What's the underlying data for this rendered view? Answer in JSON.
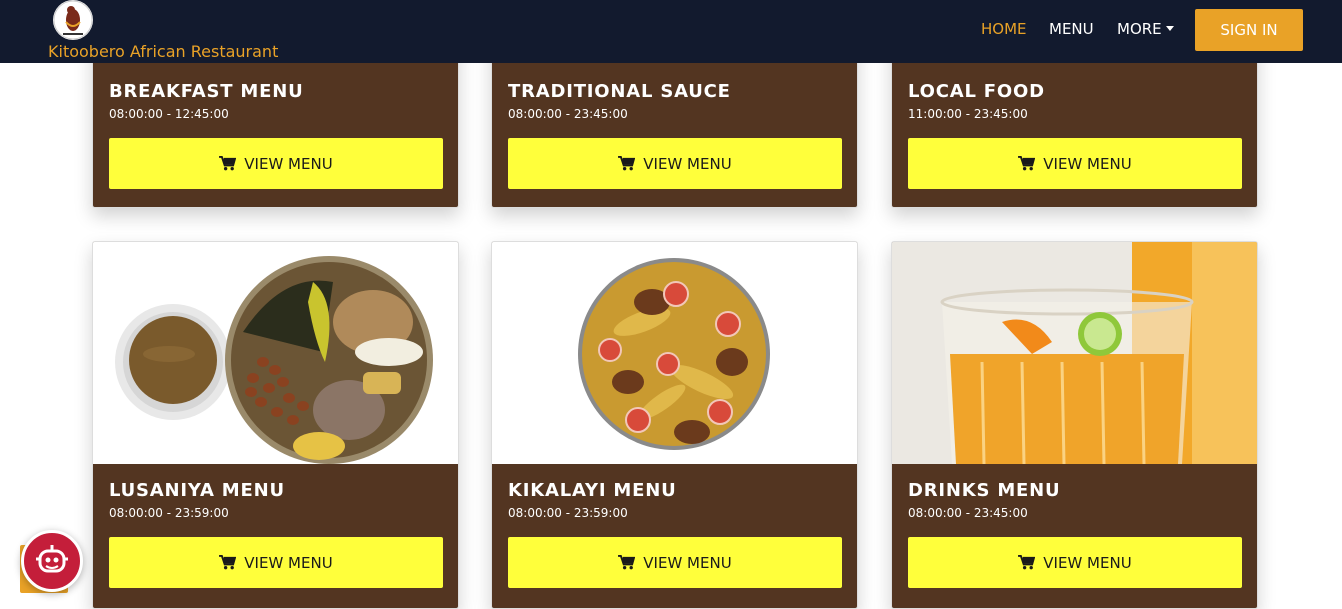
{
  "brand": {
    "name": "Kitoobero African Restaurant",
    "logo_icon": "restaurant-logo-icon"
  },
  "nav": {
    "home": "HOME",
    "menu": "MENU",
    "more": "MORE",
    "sign_in": "SIGN IN"
  },
  "cards": [
    {
      "title": "BREAKFAST MENU",
      "hours": "08:00:00 - 12:45:00",
      "button": "VIEW MENU"
    },
    {
      "title": "TRADITIONAL SAUCE",
      "hours": "08:00:00 - 23:45:00",
      "button": "VIEW MENU"
    },
    {
      "title": "LOCAL FOOD",
      "hours": "11:00:00 - 23:45:00",
      "button": "VIEW MENU"
    },
    {
      "title": "LUSANIYA MENU",
      "hours": "08:00:00 - 23:59:00",
      "button": "VIEW MENU"
    },
    {
      "title": "KIKALAYI MENU",
      "hours": "08:00:00 - 23:59:00",
      "button": "VIEW MENU"
    },
    {
      "title": "DRINKS MENU",
      "hours": "08:00:00 - 23:45:00",
      "button": "VIEW MENU"
    }
  ],
  "colors": {
    "navbar": "#121a2e",
    "accent": "#e9a227",
    "card": "#533521",
    "button": "#ffff3b",
    "chatbot": "#c41e3a"
  },
  "icons": {
    "cart": "cart-icon",
    "chatbot": "chatbot-icon",
    "caret": "caret-down-icon"
  }
}
